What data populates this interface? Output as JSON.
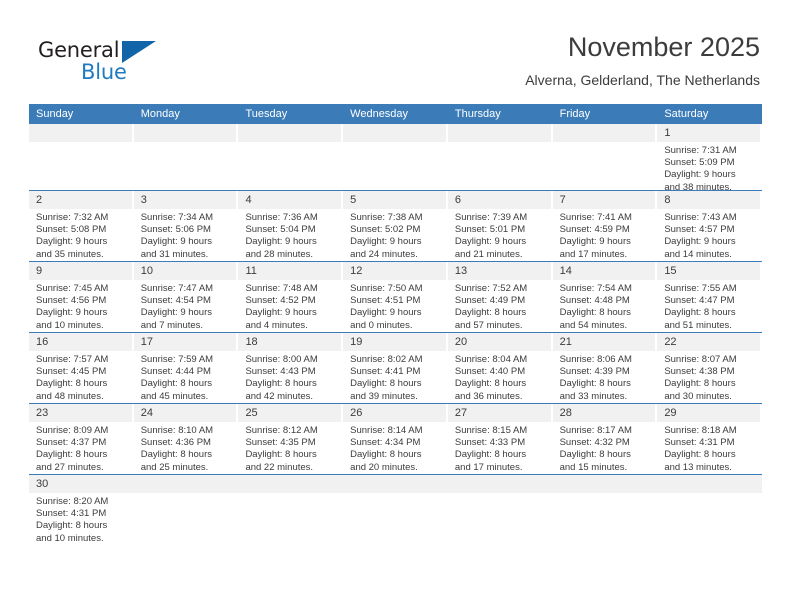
{
  "brand": {
    "name_part1": "General",
    "name_part2": "Blue",
    "flag_icon": "blue-triangle-flag"
  },
  "header": {
    "title": "November 2025",
    "subtitle": "Alverna, Gelderland, The Netherlands"
  },
  "colors": {
    "header_blue": "#3b7cb8",
    "brand_blue": "#1f7ac0",
    "date_band_gray": "#f1f1f1",
    "text": "#3c3c3c"
  },
  "weekdays": [
    "Sunday",
    "Monday",
    "Tuesday",
    "Wednesday",
    "Thursday",
    "Friday",
    "Saturday"
  ],
  "labels": {
    "sunrise_prefix": "Sunrise:",
    "sunset_prefix": "Sunset:",
    "daylight_prefix": "Daylight:"
  },
  "weeks": [
    [
      {
        "date": "",
        "empty": true
      },
      {
        "date": "",
        "empty": true
      },
      {
        "date": "",
        "empty": true
      },
      {
        "date": "",
        "empty": true
      },
      {
        "date": "",
        "empty": true
      },
      {
        "date": "",
        "empty": true
      },
      {
        "date": "1",
        "sunrise": "Sunrise: 7:31 AM",
        "sunset": "Sunset: 5:09 PM",
        "daylight_line1": "Daylight: 9 hours",
        "daylight_line2": "and 38 minutes."
      }
    ],
    [
      {
        "date": "2",
        "sunrise": "Sunrise: 7:32 AM",
        "sunset": "Sunset: 5:08 PM",
        "daylight_line1": "Daylight: 9 hours",
        "daylight_line2": "and 35 minutes."
      },
      {
        "date": "3",
        "sunrise": "Sunrise: 7:34 AM",
        "sunset": "Sunset: 5:06 PM",
        "daylight_line1": "Daylight: 9 hours",
        "daylight_line2": "and 31 minutes."
      },
      {
        "date": "4",
        "sunrise": "Sunrise: 7:36 AM",
        "sunset": "Sunset: 5:04 PM",
        "daylight_line1": "Daylight: 9 hours",
        "daylight_line2": "and 28 minutes."
      },
      {
        "date": "5",
        "sunrise": "Sunrise: 7:38 AM",
        "sunset": "Sunset: 5:02 PM",
        "daylight_line1": "Daylight: 9 hours",
        "daylight_line2": "and 24 minutes."
      },
      {
        "date": "6",
        "sunrise": "Sunrise: 7:39 AM",
        "sunset": "Sunset: 5:01 PM",
        "daylight_line1": "Daylight: 9 hours",
        "daylight_line2": "and 21 minutes."
      },
      {
        "date": "7",
        "sunrise": "Sunrise: 7:41 AM",
        "sunset": "Sunset: 4:59 PM",
        "daylight_line1": "Daylight: 9 hours",
        "daylight_line2": "and 17 minutes."
      },
      {
        "date": "8",
        "sunrise": "Sunrise: 7:43 AM",
        "sunset": "Sunset: 4:57 PM",
        "daylight_line1": "Daylight: 9 hours",
        "daylight_line2": "and 14 minutes."
      }
    ],
    [
      {
        "date": "9",
        "sunrise": "Sunrise: 7:45 AM",
        "sunset": "Sunset: 4:56 PM",
        "daylight_line1": "Daylight: 9 hours",
        "daylight_line2": "and 10 minutes."
      },
      {
        "date": "10",
        "sunrise": "Sunrise: 7:47 AM",
        "sunset": "Sunset: 4:54 PM",
        "daylight_line1": "Daylight: 9 hours",
        "daylight_line2": "and 7 minutes."
      },
      {
        "date": "11",
        "sunrise": "Sunrise: 7:48 AM",
        "sunset": "Sunset: 4:52 PM",
        "daylight_line1": "Daylight: 9 hours",
        "daylight_line2": "and 4 minutes."
      },
      {
        "date": "12",
        "sunrise": "Sunrise: 7:50 AM",
        "sunset": "Sunset: 4:51 PM",
        "daylight_line1": "Daylight: 9 hours",
        "daylight_line2": "and 0 minutes."
      },
      {
        "date": "13",
        "sunrise": "Sunrise: 7:52 AM",
        "sunset": "Sunset: 4:49 PM",
        "daylight_line1": "Daylight: 8 hours",
        "daylight_line2": "and 57 minutes."
      },
      {
        "date": "14",
        "sunrise": "Sunrise: 7:54 AM",
        "sunset": "Sunset: 4:48 PM",
        "daylight_line1": "Daylight: 8 hours",
        "daylight_line2": "and 54 minutes."
      },
      {
        "date": "15",
        "sunrise": "Sunrise: 7:55 AM",
        "sunset": "Sunset: 4:47 PM",
        "daylight_line1": "Daylight: 8 hours",
        "daylight_line2": "and 51 minutes."
      }
    ],
    [
      {
        "date": "16",
        "sunrise": "Sunrise: 7:57 AM",
        "sunset": "Sunset: 4:45 PM",
        "daylight_line1": "Daylight: 8 hours",
        "daylight_line2": "and 48 minutes."
      },
      {
        "date": "17",
        "sunrise": "Sunrise: 7:59 AM",
        "sunset": "Sunset: 4:44 PM",
        "daylight_line1": "Daylight: 8 hours",
        "daylight_line2": "and 45 minutes."
      },
      {
        "date": "18",
        "sunrise": "Sunrise: 8:00 AM",
        "sunset": "Sunset: 4:43 PM",
        "daylight_line1": "Daylight: 8 hours",
        "daylight_line2": "and 42 minutes."
      },
      {
        "date": "19",
        "sunrise": "Sunrise: 8:02 AM",
        "sunset": "Sunset: 4:41 PM",
        "daylight_line1": "Daylight: 8 hours",
        "daylight_line2": "and 39 minutes."
      },
      {
        "date": "20",
        "sunrise": "Sunrise: 8:04 AM",
        "sunset": "Sunset: 4:40 PM",
        "daylight_line1": "Daylight: 8 hours",
        "daylight_line2": "and 36 minutes."
      },
      {
        "date": "21",
        "sunrise": "Sunrise: 8:06 AM",
        "sunset": "Sunset: 4:39 PM",
        "daylight_line1": "Daylight: 8 hours",
        "daylight_line2": "and 33 minutes."
      },
      {
        "date": "22",
        "sunrise": "Sunrise: 8:07 AM",
        "sunset": "Sunset: 4:38 PM",
        "daylight_line1": "Daylight: 8 hours",
        "daylight_line2": "and 30 minutes."
      }
    ],
    [
      {
        "date": "23",
        "sunrise": "Sunrise: 8:09 AM",
        "sunset": "Sunset: 4:37 PM",
        "daylight_line1": "Daylight: 8 hours",
        "daylight_line2": "and 27 minutes."
      },
      {
        "date": "24",
        "sunrise": "Sunrise: 8:10 AM",
        "sunset": "Sunset: 4:36 PM",
        "daylight_line1": "Daylight: 8 hours",
        "daylight_line2": "and 25 minutes."
      },
      {
        "date": "25",
        "sunrise": "Sunrise: 8:12 AM",
        "sunset": "Sunset: 4:35 PM",
        "daylight_line1": "Daylight: 8 hours",
        "daylight_line2": "and 22 minutes."
      },
      {
        "date": "26",
        "sunrise": "Sunrise: 8:14 AM",
        "sunset": "Sunset: 4:34 PM",
        "daylight_line1": "Daylight: 8 hours",
        "daylight_line2": "and 20 minutes."
      },
      {
        "date": "27",
        "sunrise": "Sunrise: 8:15 AM",
        "sunset": "Sunset: 4:33 PM",
        "daylight_line1": "Daylight: 8 hours",
        "daylight_line2": "and 17 minutes."
      },
      {
        "date": "28",
        "sunrise": "Sunrise: 8:17 AM",
        "sunset": "Sunset: 4:32 PM",
        "daylight_line1": "Daylight: 8 hours",
        "daylight_line2": "and 15 minutes."
      },
      {
        "date": "29",
        "sunrise": "Sunrise: 8:18 AM",
        "sunset": "Sunset: 4:31 PM",
        "daylight_line1": "Daylight: 8 hours",
        "daylight_line2": "and 13 minutes."
      }
    ],
    [
      {
        "date": "30",
        "sunrise": "Sunrise: 8:20 AM",
        "sunset": "Sunset: 4:31 PM",
        "daylight_line1": "Daylight: 8 hours",
        "daylight_line2": "and 10 minutes."
      },
      {
        "date": "",
        "empty": true
      },
      {
        "date": "",
        "empty": true
      },
      {
        "date": "",
        "empty": true
      },
      {
        "date": "",
        "empty": true
      },
      {
        "date": "",
        "empty": true
      },
      {
        "date": "",
        "empty": true
      }
    ]
  ]
}
